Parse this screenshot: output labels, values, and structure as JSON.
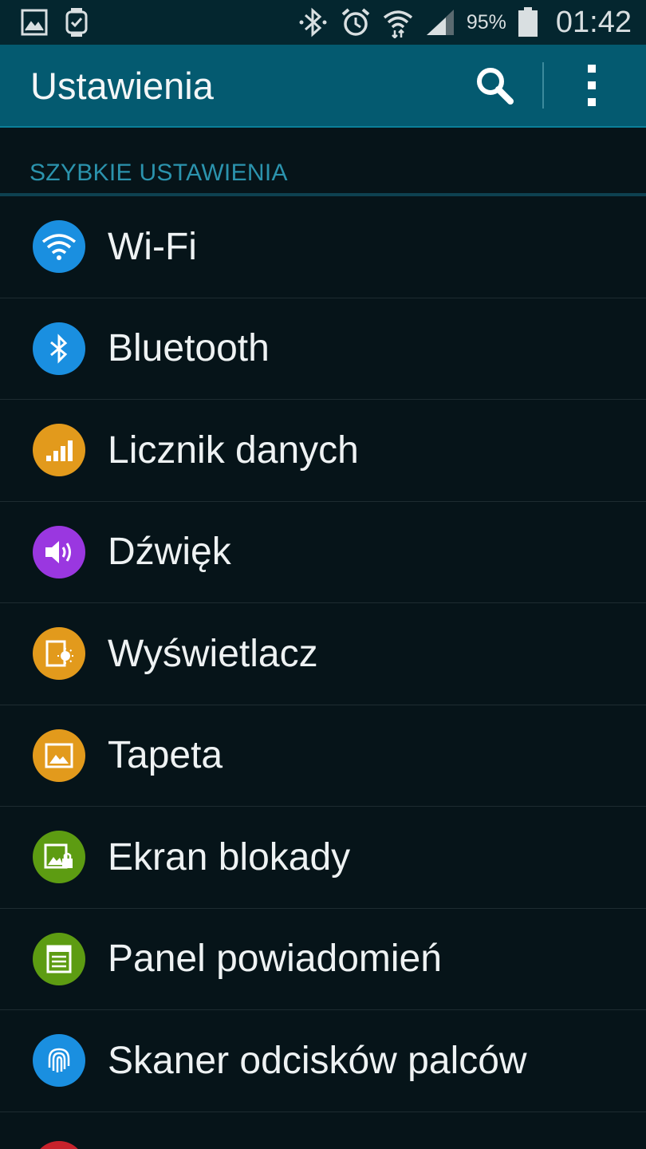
{
  "status_bar": {
    "battery_percent": "95%",
    "time": "01:42"
  },
  "action_bar": {
    "title": "Ustawienia"
  },
  "section": {
    "title": "SZYBKIE USTAWIENIA"
  },
  "items": [
    {
      "label": "Wi-Fi",
      "icon": "wifi-icon",
      "color": "#1a8fe0"
    },
    {
      "label": "Bluetooth",
      "icon": "bluetooth-icon",
      "color": "#1a8fe0"
    },
    {
      "label": "Licznik danych",
      "icon": "data-usage-icon",
      "color": "#e29a1c"
    },
    {
      "label": "Dźwięk",
      "icon": "sound-icon",
      "color": "#9a37e0"
    },
    {
      "label": "Wyświetlacz",
      "icon": "display-icon",
      "color": "#e29a1c"
    },
    {
      "label": "Tapeta",
      "icon": "wallpaper-icon",
      "color": "#e29a1c"
    },
    {
      "label": "Ekran blokady",
      "icon": "lock-screen-icon",
      "color": "#5d9c12"
    },
    {
      "label": "Panel powiadomień",
      "icon": "notification-panel-icon",
      "color": "#5d9c12"
    },
    {
      "label": "Skaner odcisków palców",
      "icon": "fingerprint-icon",
      "color": "#1a8fe0"
    }
  ],
  "partial_item_color": "#c8222b"
}
